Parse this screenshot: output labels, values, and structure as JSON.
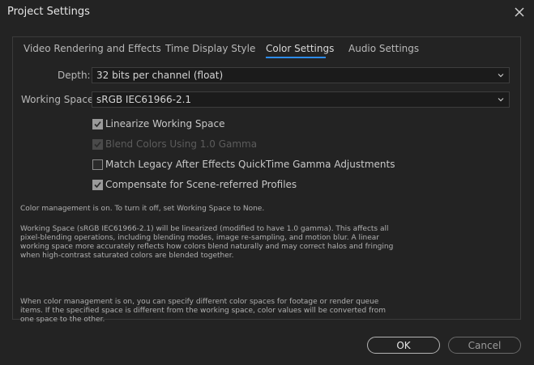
{
  "window": {
    "title": "Project Settings"
  },
  "tabs": [
    {
      "label": "Video Rendering and Effects"
    },
    {
      "label": "Time Display Style"
    },
    {
      "label": "Color Settings"
    },
    {
      "label": "Audio Settings"
    }
  ],
  "active_tab": "Color Settings",
  "depth": {
    "label": "Depth:",
    "value": "32 bits per channel (float)"
  },
  "working_space": {
    "label": "Working Space:",
    "value": "sRGB IEC61966-2.1"
  },
  "checkboxes": [
    {
      "label": "Linearize Working Space",
      "checked": true,
      "enabled": true
    },
    {
      "label": "Blend Colors Using 1.0 Gamma",
      "checked": true,
      "enabled": false
    },
    {
      "label": "Match Legacy After Effects QuickTime Gamma Adjustments",
      "checked": false,
      "enabled": true
    },
    {
      "label": "Compensate for Scene-referred Profiles",
      "checked": true,
      "enabled": true
    }
  ],
  "notes": {
    "management_on": "Color management is on. To turn it off, set Working Space to None.",
    "linearized": "Working Space (sRGB IEC61966-2.1) will be linearized (modified to have 1.0 gamma). This affects all pixel-blending operations, including blending modes, image re-sampling, and motion blur. A linear working space more accurately reflects how colors blend naturally and may correct halos and fringing when high-contrast saturated colors are blended together.",
    "color_spaces": "When color management is on, you can specify different color spaces for footage or render queue items. If the specified space is different from the working space, color values will be converted from one space to the other."
  },
  "buttons": {
    "ok": "OK",
    "cancel": "Cancel"
  },
  "colors": {
    "accent": "#2d8ceb",
    "background": "#232323",
    "field": "#1b1b1b"
  }
}
